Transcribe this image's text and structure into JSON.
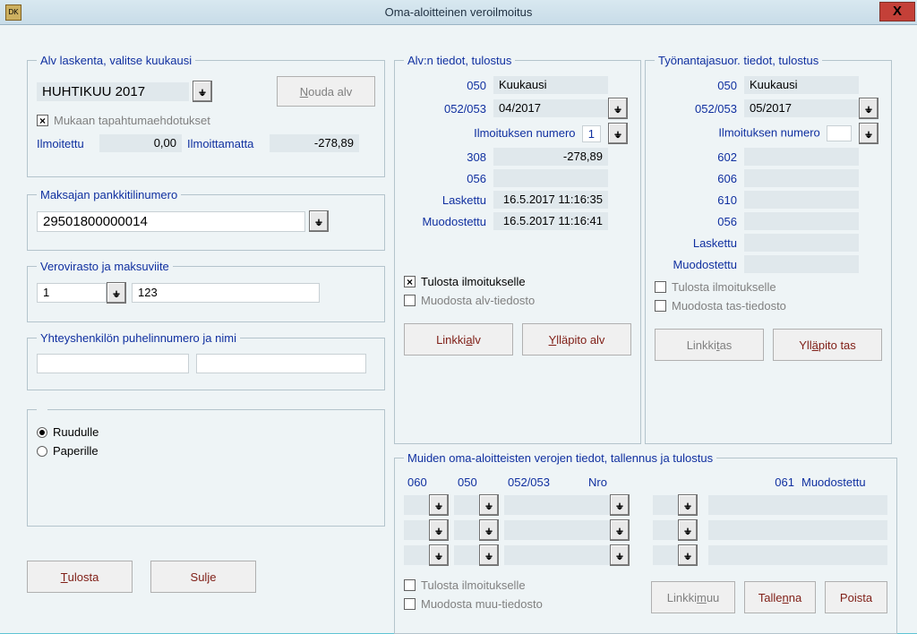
{
  "window": {
    "title": "Oma-aloitteinen veroilmoitus"
  },
  "alvCalc": {
    "legend": "Alv laskenta, valitse kuukausi",
    "month": "HUHTIKUU 2017",
    "noudaBtn": "Nouda alv",
    "mukaan_label": "Mukaan tapahtumaehdotukset",
    "ilmoitettu_label": "Ilmoitettu",
    "ilmoitettu_value": "0,00",
    "ilmoittamatta_label": "Ilmoittamatta",
    "ilmoittamatta_value": "-278,89"
  },
  "bank": {
    "legend": "Maksajan pankkitilinumero",
    "account": "29501800000014"
  },
  "taxOffice": {
    "legend": "Verovirasto ja maksuviite",
    "code": "1",
    "ref": "123"
  },
  "contact": {
    "legend": "Yhteyshenkilön puhelinnumero ja nimi"
  },
  "output": {
    "ruudulle": "Ruudulle",
    "paperille": "Paperille"
  },
  "bottom": {
    "tulosta": "Tulosta",
    "sulje": "Sulje"
  },
  "alvInfo": {
    "legend": "Alv:n tiedot, tulostus",
    "fields": {
      "f050_label": "050",
      "f050_name": "Kuukausi",
      "f052_label": "052/053",
      "f052_value": "04/2017",
      "ilm_label": "Ilmoituksen numero",
      "ilm_value": "1",
      "f308_label": "308",
      "f308_value": "-278,89",
      "f056_label": "056",
      "laskettu_label": "Laskettu",
      "laskettu_value": "16.5.2017 11:16:35",
      "muod_label": "Muodostettu",
      "muod_value": "16.5.2017 11:16:41"
    },
    "tulosta_cb": "Tulosta ilmoitukselle",
    "muodosta_cb": "Muodosta alv-tiedosto",
    "linkki": "Linkki alv",
    "yllapito": "Ylläpito alv"
  },
  "tyon": {
    "legend": "Työnantajasuor. tiedot, tulostus",
    "fields": {
      "f050_label": "050",
      "f050_name": "Kuukausi",
      "f052_label": "052/053",
      "f052_value": "05/2017",
      "ilm_label": "Ilmoituksen numero",
      "f602_label": "602",
      "f606_label": "606",
      "f610_label": "610",
      "f056_label": "056",
      "laskettu_label": "Laskettu",
      "muod_label": "Muodostettu"
    },
    "tulosta_cb": "Tulosta ilmoitukselle",
    "muodosta_cb": "Muodosta tas-tiedosto",
    "linkki": "Linkki tas",
    "yllapito": "Ylläpito tas"
  },
  "muut": {
    "legend": "Muiden oma-aloitteisten verojen tiedot, tallennus ja tulostus",
    "headers": {
      "h060": "060",
      "h050": "050",
      "h052": "052/053",
      "hnro": "Nro",
      "h061": "061",
      "hmuod": "Muodostettu"
    },
    "tulosta_cb": "Tulosta ilmoitukselle",
    "muodosta_cb": "Muodosta muu-tiedosto",
    "linkki": "Linkki muu",
    "tallenna": "Tallenna",
    "poista": "Poista"
  }
}
